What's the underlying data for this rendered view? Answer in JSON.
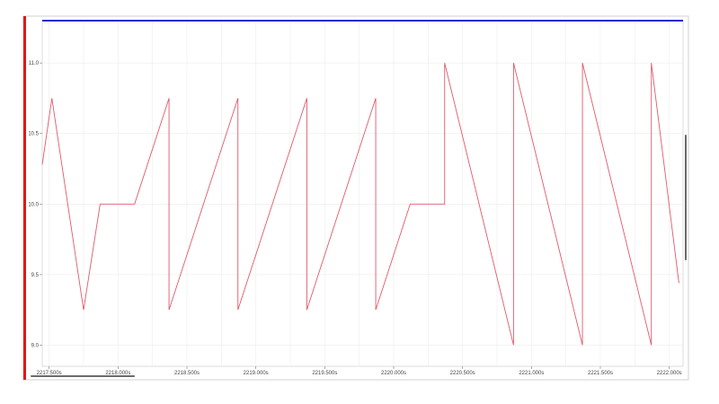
{
  "chart_data": {
    "type": "line",
    "title": "",
    "xlabel": "",
    "ylabel": "",
    "xlim": [
      2217.45,
      2222.1
    ],
    "ylim": [
      8.85,
      11.3
    ],
    "x_ticks": [
      {
        "value": 2217.5,
        "label": "2217.500s"
      },
      {
        "value": 2218.0,
        "label": "2218.000s"
      },
      {
        "value": 2218.5,
        "label": "2218.500s"
      },
      {
        "value": 2219.0,
        "label": "2219.000s"
      },
      {
        "value": 2219.5,
        "label": "2219.500s"
      },
      {
        "value": 2220.0,
        "label": "2220.000s"
      },
      {
        "value": 2220.5,
        "label": "2220.500s"
      },
      {
        "value": 2221.0,
        "label": "2221.000s"
      },
      {
        "value": 2221.5,
        "label": "2221.500s"
      },
      {
        "value": 2222.0,
        "label": "2222.000s"
      }
    ],
    "y_ticks": [
      {
        "value": 9.0,
        "label": "9.0"
      },
      {
        "value": 9.5,
        "label": "9.5"
      },
      {
        "value": 10.0,
        "label": "10.0"
      },
      {
        "value": 10.5,
        "label": "10.5"
      },
      {
        "value": 11.0,
        "label": "11.0"
      }
    ],
    "grid": true,
    "series": [
      {
        "color": "#e05a6a",
        "x": [
          2217.45,
          2217.52,
          2217.75,
          2217.87,
          2218.12,
          2218.37,
          2218.37,
          2218.87,
          2218.87,
          2219.37,
          2219.37,
          2219.87,
          2219.87,
          2220.12,
          2220.37,
          2220.37,
          2220.87,
          2220.87,
          2221.37,
          2221.37,
          2221.87,
          2221.87,
          2222.07
        ],
        "y": [
          10.28,
          10.75,
          9.25,
          10.0,
          10.0,
          10.75,
          9.25,
          10.75,
          9.25,
          10.75,
          9.25,
          10.75,
          9.25,
          10.0,
          10.0,
          11.0,
          9.0,
          11.0,
          9.0,
          11.0,
          9.0,
          11.0,
          9.44
        ]
      }
    ]
  },
  "colors": {
    "trace": "#e05a6a",
    "top_border": "#1f2ad4",
    "left_marker": "#e01818",
    "grid": "#ececec",
    "frame": "#b9b9b9",
    "scrollbar": "#6a6a6a"
  }
}
